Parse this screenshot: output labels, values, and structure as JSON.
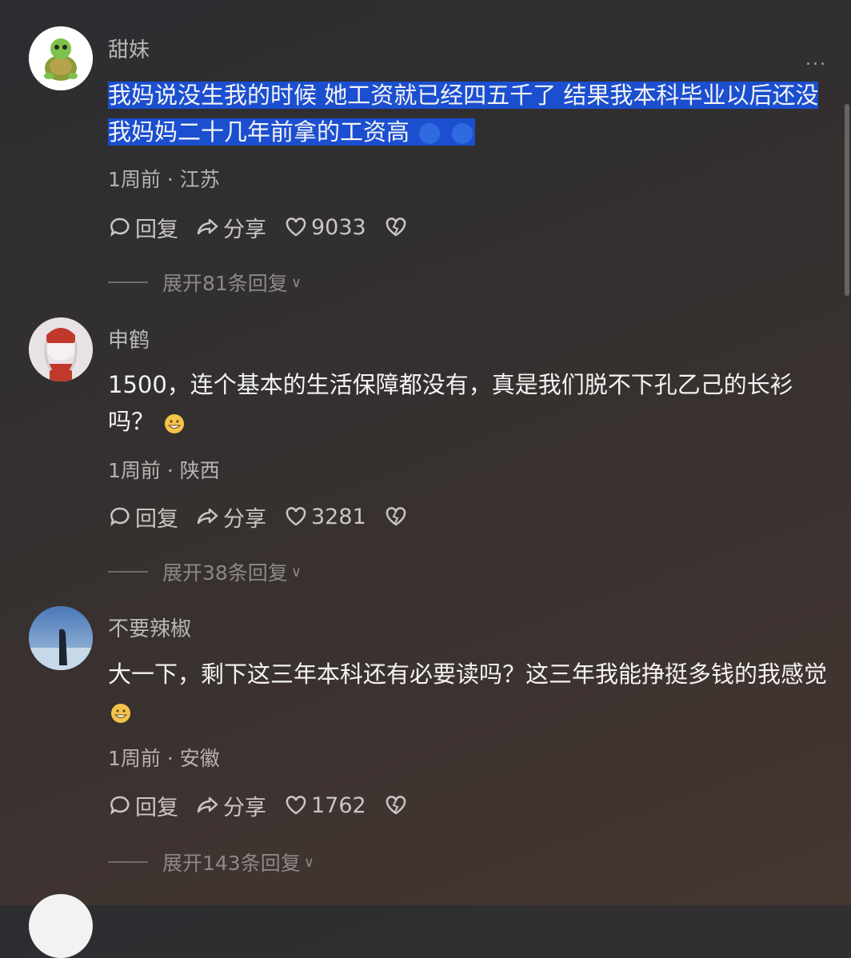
{
  "menu": {
    "more_label": "..."
  },
  "comments": [
    {
      "username": "甜妹",
      "content": "我妈说没生我的时候 她工资就已经四五千了 结果我本科毕业以后还没我妈妈二十几年前拿的工资高",
      "meta": "1周前 · 江苏",
      "reply_label": "回复",
      "share_label": "分享",
      "likes": "9033",
      "expand_label": "展开81条回复"
    },
    {
      "username": "申鹤",
      "content": "1500，连个基本的生活保障都没有，真是我们脱不下孔乙己的长衫吗？",
      "meta": "1周前 · 陕西",
      "reply_label": "回复",
      "share_label": "分享",
      "likes": "3281",
      "expand_label": "展开38条回复"
    },
    {
      "username": "不要辣椒",
      "content": "大一下，剩下这三年本科还有必要读吗？这三年我能挣挺多钱的我感觉",
      "meta": "1周前 · 安徽",
      "reply_label": "回复",
      "share_label": "分享",
      "likes": "1762",
      "expand_label": "展开143条回复"
    }
  ],
  "colors": {
    "selection": "#1b4fd0",
    "background": "#2f2f33"
  }
}
